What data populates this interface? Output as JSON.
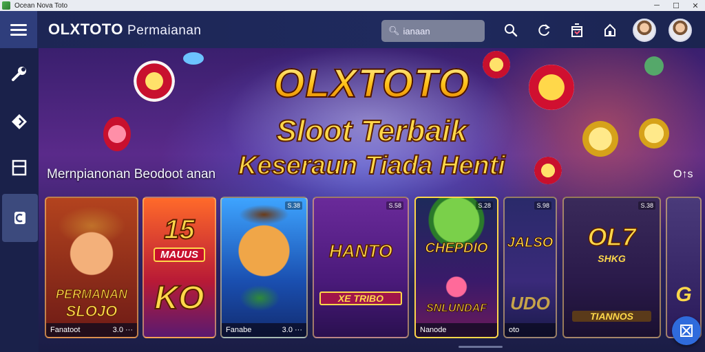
{
  "window": {
    "title": "Ocean Nova Toto"
  },
  "header": {
    "brand": "OLXTOTO",
    "subtitle": "Permaianan",
    "search": {
      "value": "ianaan",
      "icon": "search-icon"
    },
    "icons": [
      "search-icon",
      "refresh-icon",
      "gift-icon",
      "home-icon"
    ]
  },
  "sidebar": {
    "items": [
      {
        "icon": "wrench-icon"
      },
      {
        "icon": "tag-icon"
      },
      {
        "icon": "document-icon"
      },
      {
        "icon": "casino-chip-icon",
        "active": true
      }
    ]
  },
  "banner": {
    "title": "OLXTOTO",
    "subtitle1": "Sloot Terbaik",
    "subtitle2": "Keseraun Tiada Henti"
  },
  "section": {
    "title": "Mernpianonan Beodoot anan",
    "more": "O↑s"
  },
  "games": [
    {
      "logo_top": "PERMANAN",
      "logo_bottom": "SLOJO",
      "footer_left": "Fanatoot",
      "footer_right": "3.0 ···",
      "badge": ""
    },
    {
      "logo_top": "15",
      "logo_mid": "MAUUS",
      "logo_bottom": "KO",
      "footer_left": "",
      "footer_right": "",
      "badge": ""
    },
    {
      "logo_top": "",
      "logo_bottom": "",
      "footer_left": "Fanabe",
      "footer_right": "3.0 ···",
      "badge": "S.38"
    },
    {
      "logo_top": "HANTO",
      "logo_bottom": "XE TRIBO",
      "footer_left": "",
      "footer_right": "",
      "badge": "S.58"
    },
    {
      "logo_top": "CHEPDIO",
      "logo_bottom": "SNLUNDAF",
      "footer_left": "Nanode",
      "footer_right": "",
      "badge": "S.28"
    },
    {
      "logo_top": "JALSO",
      "logo_bottom": "UDO",
      "footer_left": "oto",
      "footer_right": "",
      "badge": "S.98"
    },
    {
      "logo_top": "OL7",
      "logo_mid": "SHKG",
      "logo_bottom": "TIANNOS",
      "footer_left": "",
      "footer_right": "",
      "badge": "S.38"
    },
    {
      "logo_top": "G",
      "logo_bottom": "",
      "footer_left": "",
      "footer_right": "",
      "badge": ""
    }
  ],
  "colors": {
    "accent": "#2f6bdc",
    "topbar": "#1f2a5e",
    "sidebar": "#1a214a",
    "gold": "#ffc21a"
  }
}
